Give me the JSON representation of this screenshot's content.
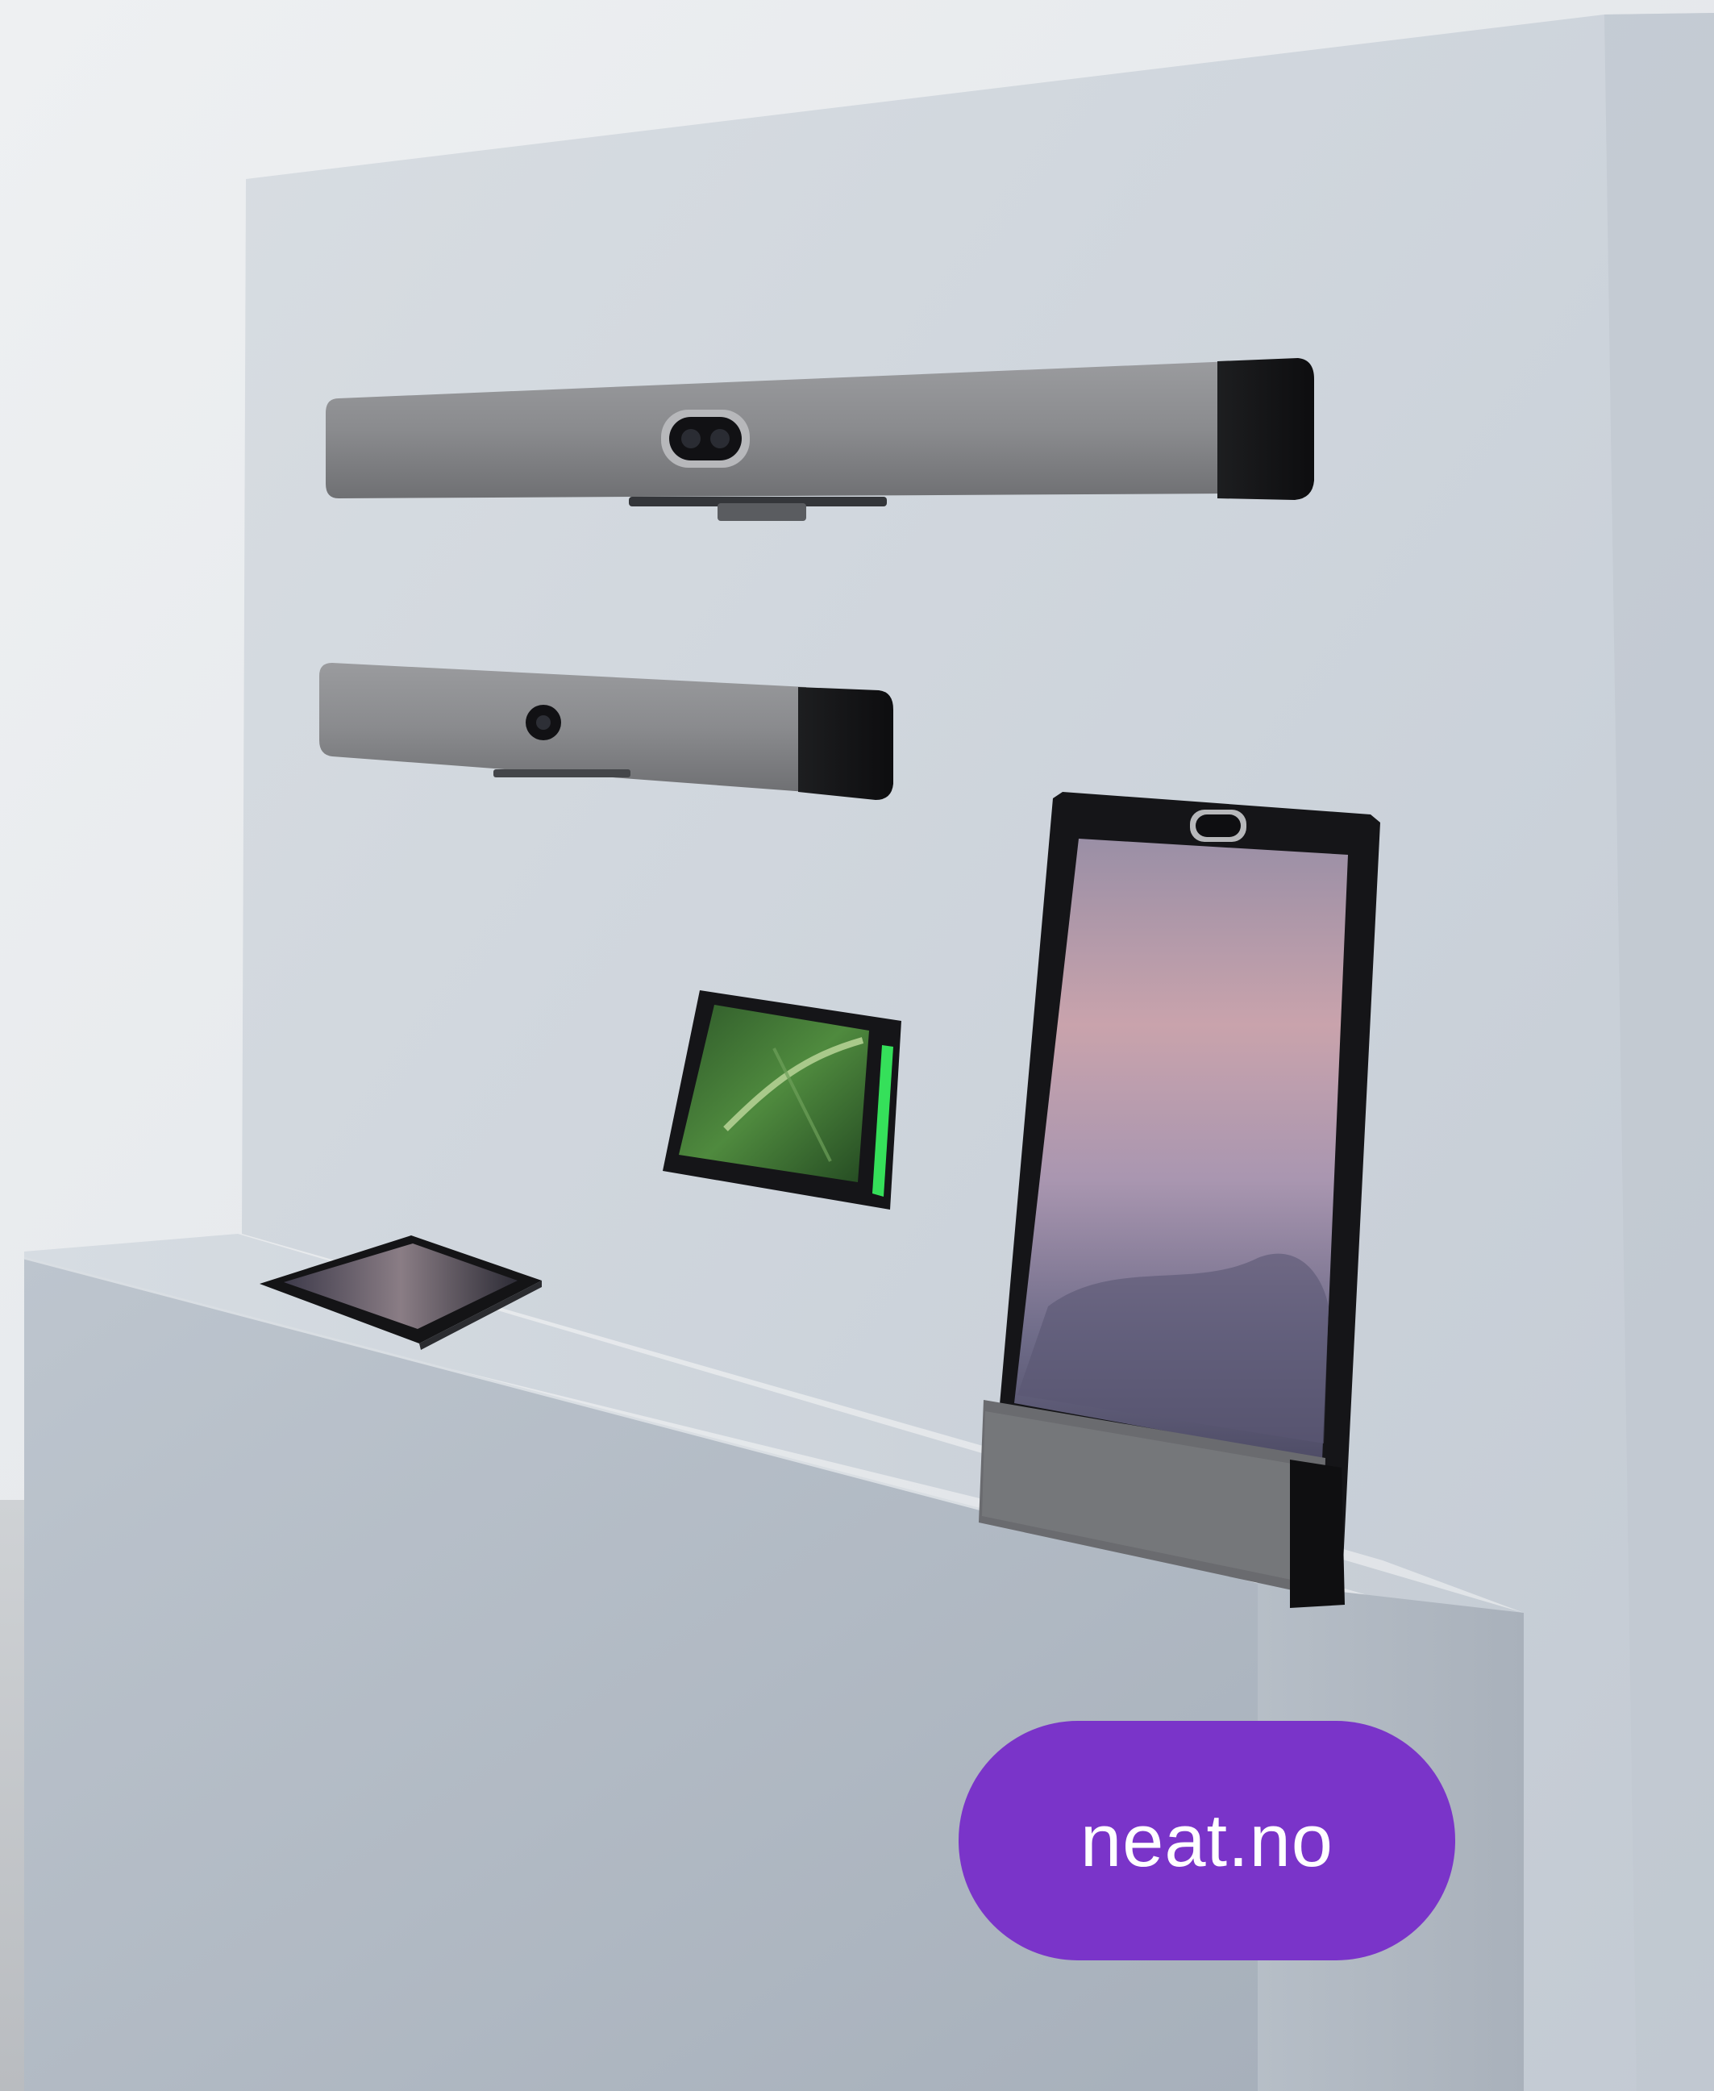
{
  "photo": {
    "subject": "neat-devices-display-stand",
    "colors": {
      "room_wall": "#e8ebee",
      "stand_panel": "#ccd3db",
      "stand_front": "#b3bbc5",
      "fabric": "#8a8b8e",
      "device_black": "#141416",
      "status_light": "#35e05a",
      "pill": "#7a34c9"
    }
  },
  "link_pill": {
    "label": "neat.no",
    "color": "#7a34c9",
    "text_color": "#ffffff"
  }
}
